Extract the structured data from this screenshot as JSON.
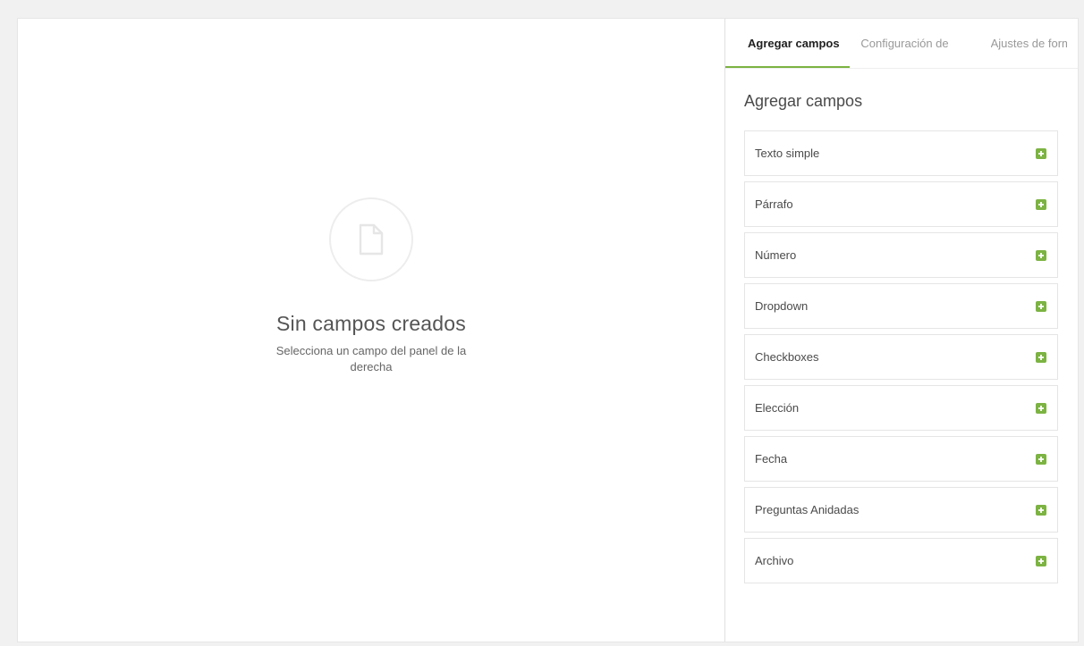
{
  "canvas": {
    "empty_icon": "document-icon",
    "empty_title": "Sin campos creados",
    "empty_subtitle": "Selecciona un campo del panel de la derecha"
  },
  "panel": {
    "tabs": [
      {
        "label": "Agregar campos",
        "active": true
      },
      {
        "label": "Configuración de",
        "active": false
      },
      {
        "label": "Ajustes de formulario",
        "active": false
      }
    ],
    "section_title": "Agregar campos",
    "add_icon": "plus-square-icon",
    "fields": [
      {
        "label": "Texto simple"
      },
      {
        "label": "Párrafo"
      },
      {
        "label": "Número"
      },
      {
        "label": "Dropdown"
      },
      {
        "label": "Checkboxes"
      },
      {
        "label": "Elección"
      },
      {
        "label": "Fecha"
      },
      {
        "label": "Preguntas Anidadas"
      },
      {
        "label": "Archivo"
      }
    ]
  },
  "colors": {
    "accent": "#7cb342",
    "background": "#f1f1f1",
    "surface": "#ffffff",
    "border": "#e5e5e5"
  }
}
